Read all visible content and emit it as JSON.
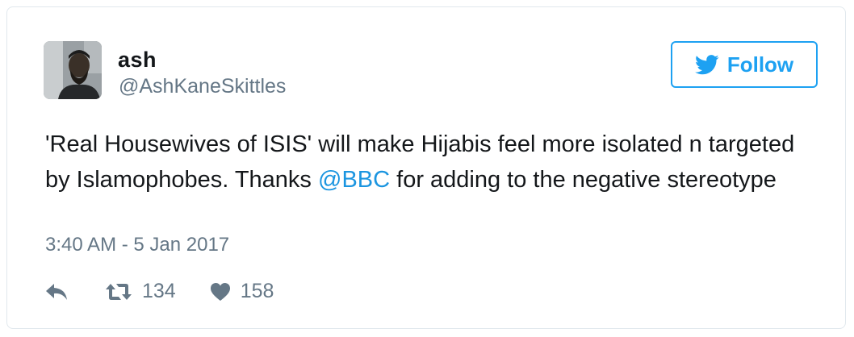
{
  "user": {
    "display_name": "ash",
    "handle": "@AshKaneSkittles"
  },
  "follow_button": {
    "label": "Follow"
  },
  "tweet": {
    "text_part1": "'Real Housewives of ISIS' will make Hijabis feel more isolated n targeted by Islamophobes. Thanks ",
    "mention": "@BBC",
    "text_part2": " for adding to the negative stereotype",
    "timestamp": "3:40 AM - 5 Jan 2017"
  },
  "actions": {
    "reply_icon": "reply-icon",
    "retweet_icon": "retweet-icon",
    "like_icon": "heart-icon",
    "retweet_count": "134",
    "like_count": "158"
  },
  "colors": {
    "accent": "#1da1f2",
    "mention": "#1b95e0",
    "secondary_text": "#657786",
    "border": "#e1e8ed"
  }
}
